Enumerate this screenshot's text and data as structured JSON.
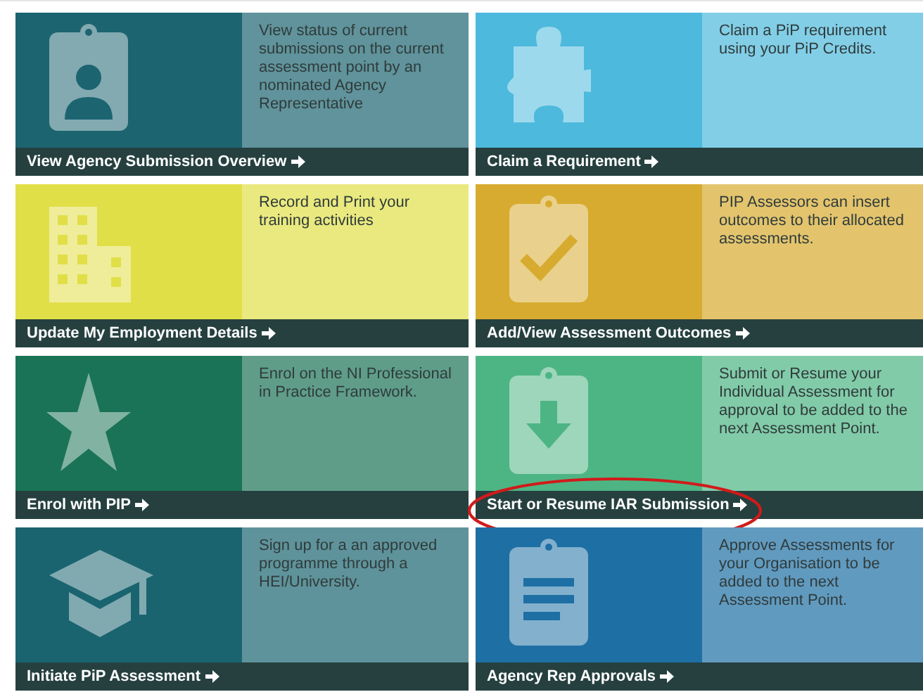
{
  "tiles": [
    {
      "kind": "id-badge",
      "title": "View Agency Submission Overview",
      "description": "View status of current submissions on the current assessment point by an nominated Agency Representative",
      "highlighted": false,
      "color": "#1c6470"
    },
    {
      "kind": "puzzle",
      "title": "Claim a Requirement",
      "description": "Claim a PiP requirement using your PiP Credits.",
      "highlighted": false,
      "color": "#4db9dd"
    },
    {
      "kind": "building",
      "title": "Update My Employment Details",
      "description": "Record and Print your training activities",
      "highlighted": false,
      "color": "#e1df48"
    },
    {
      "kind": "clipboard-check",
      "title": "Add/View Assessment Outcomes",
      "description": "PIP Assessors can insert outcomes to their allocated assessments.",
      "highlighted": false,
      "color": "#d7ab2f"
    },
    {
      "kind": "star",
      "title": "Enrol with PIP",
      "description": "Enrol on the NI Professional in Practice Framework.",
      "highlighted": false,
      "color": "#1a7356"
    },
    {
      "kind": "clipboard-download",
      "title": "Start or Resume IAR Submission",
      "description": "Submit or Resume your Individual Assessment for approval to be added to the next Assessment Point.",
      "highlighted": true,
      "color": "#4db584"
    },
    {
      "kind": "graduation-cap",
      "title": "Initiate PiP Assessment",
      "description": "Sign up for a an approved programme through a HEI/University.",
      "highlighted": false,
      "color": "#1a6470"
    },
    {
      "kind": "clipboard-list",
      "title": "Agency Rep Approvals",
      "description": "Approve Assessments for your Organisation to be added to the next Assessment Point.",
      "highlighted": false,
      "color": "#1d6fa4"
    }
  ]
}
